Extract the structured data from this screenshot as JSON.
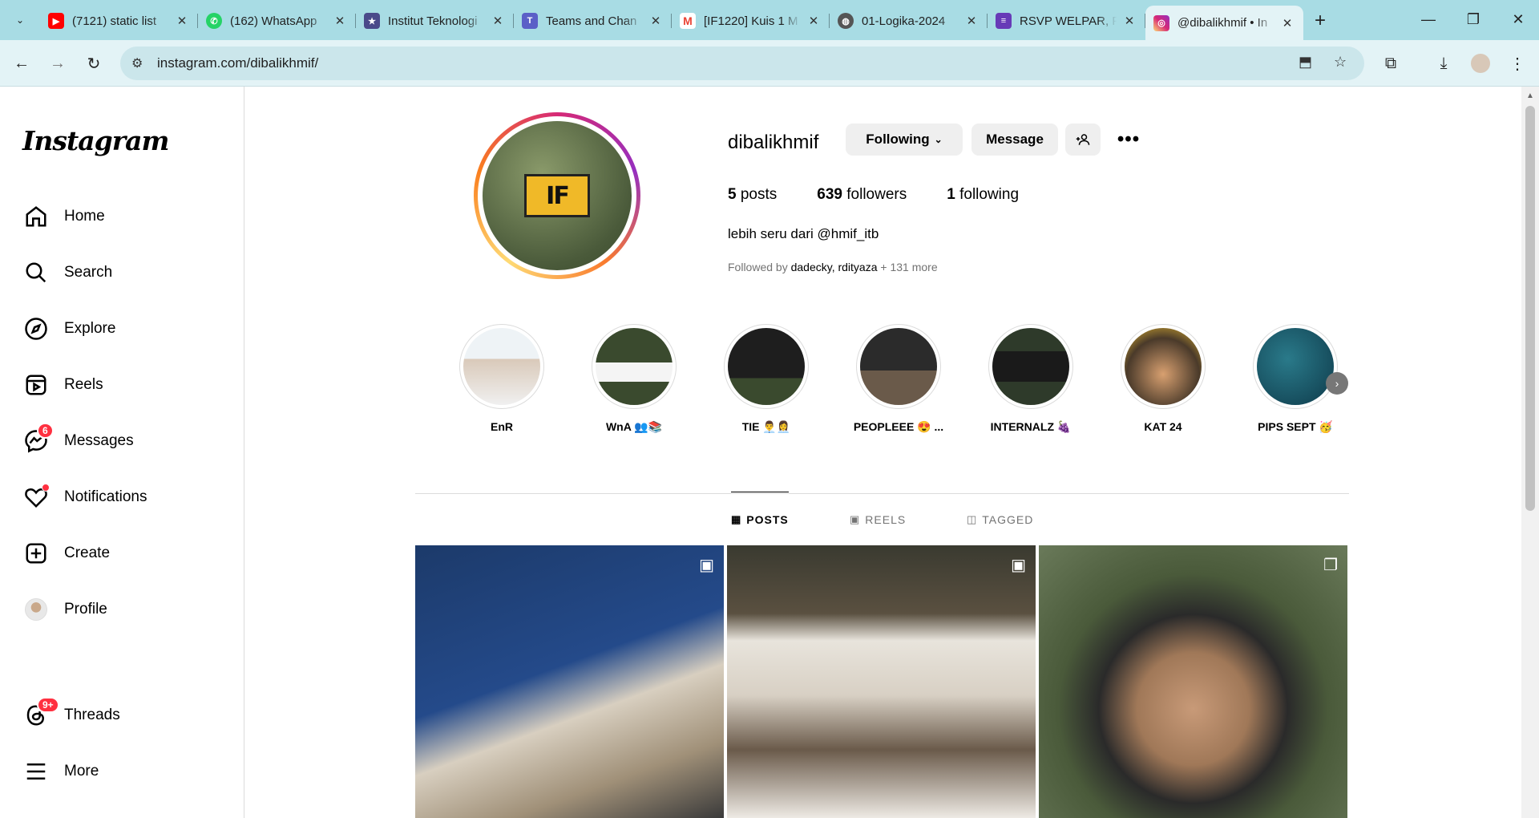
{
  "browser": {
    "tabs": [
      {
        "title": "(7121) static list",
        "icon": "youtube-icon",
        "color": "#ff0000"
      },
      {
        "title": "(162) WhatsApp",
        "icon": "whatsapp-icon",
        "color": "#25d366"
      },
      {
        "title": "Institut Teknologi",
        "icon": "itb-icon",
        "color": "#4a4a8a"
      },
      {
        "title": "Teams and Chan",
        "icon": "teams-icon",
        "color": "#5b5fc7"
      },
      {
        "title": "[IF1220] Kuis 1 M",
        "icon": "gmail-icon",
        "color": "#ea4335"
      },
      {
        "title": "01-Logika-2024",
        "icon": "globe-icon",
        "color": "#555555"
      },
      {
        "title": "RSVP WELPAR, P",
        "icon": "forms-icon",
        "color": "#673ab7"
      },
      {
        "title": "@dibalikhmif • In",
        "icon": "instagram-icon",
        "color": "#e1306c"
      }
    ],
    "url": "instagram.com/dibalikhmif/"
  },
  "sidebar": {
    "logo": "Instagram",
    "items": [
      {
        "label": "Home",
        "icon": "home-icon"
      },
      {
        "label": "Search",
        "icon": "search-icon"
      },
      {
        "label": "Explore",
        "icon": "compass-icon"
      },
      {
        "label": "Reels",
        "icon": "reels-icon"
      },
      {
        "label": "Messages",
        "icon": "messenger-icon",
        "badge": "6"
      },
      {
        "label": "Notifications",
        "icon": "heart-icon"
      },
      {
        "label": "Create",
        "icon": "plus-square-icon"
      },
      {
        "label": "Profile",
        "icon": "avatar-icon"
      },
      {
        "label": "Threads",
        "icon": "threads-icon",
        "badge": "9+"
      },
      {
        "label": "More",
        "icon": "menu-icon"
      }
    ]
  },
  "profile": {
    "username": "dibalikhmif",
    "following_label": "Following",
    "message_label": "Message",
    "posts_count": "5",
    "posts_label": "posts",
    "followers_count": "639",
    "followers_label": "followers",
    "following_count": "1",
    "following_word": "following",
    "bio": "lebih seru dari @hmif_itb",
    "followed_prefix": "Followed by",
    "followed_names": "dadecky, rdityaza",
    "followed_more": "+ 131 more",
    "avatar_logo_text": "IF"
  },
  "highlights": [
    {
      "label": "EnR"
    },
    {
      "label": "WnA 👥📚"
    },
    {
      "label": "TIE 👨‍💼👩‍💼"
    },
    {
      "label": "PEOPLEEE 😍 ..."
    },
    {
      "label": "INTERNALZ 🍇"
    },
    {
      "label": "KAT 24"
    },
    {
      "label": "PIPS SEPT 🥳"
    }
  ],
  "post_tabs": [
    {
      "label": "POSTS",
      "icon": "grid-icon"
    },
    {
      "label": "REELS",
      "icon": "reels-icon"
    },
    {
      "label": "TAGGED",
      "icon": "tagged-icon"
    }
  ],
  "posts": [
    {
      "type": "reel"
    },
    {
      "type": "reel"
    },
    {
      "type": "carousel"
    }
  ]
}
